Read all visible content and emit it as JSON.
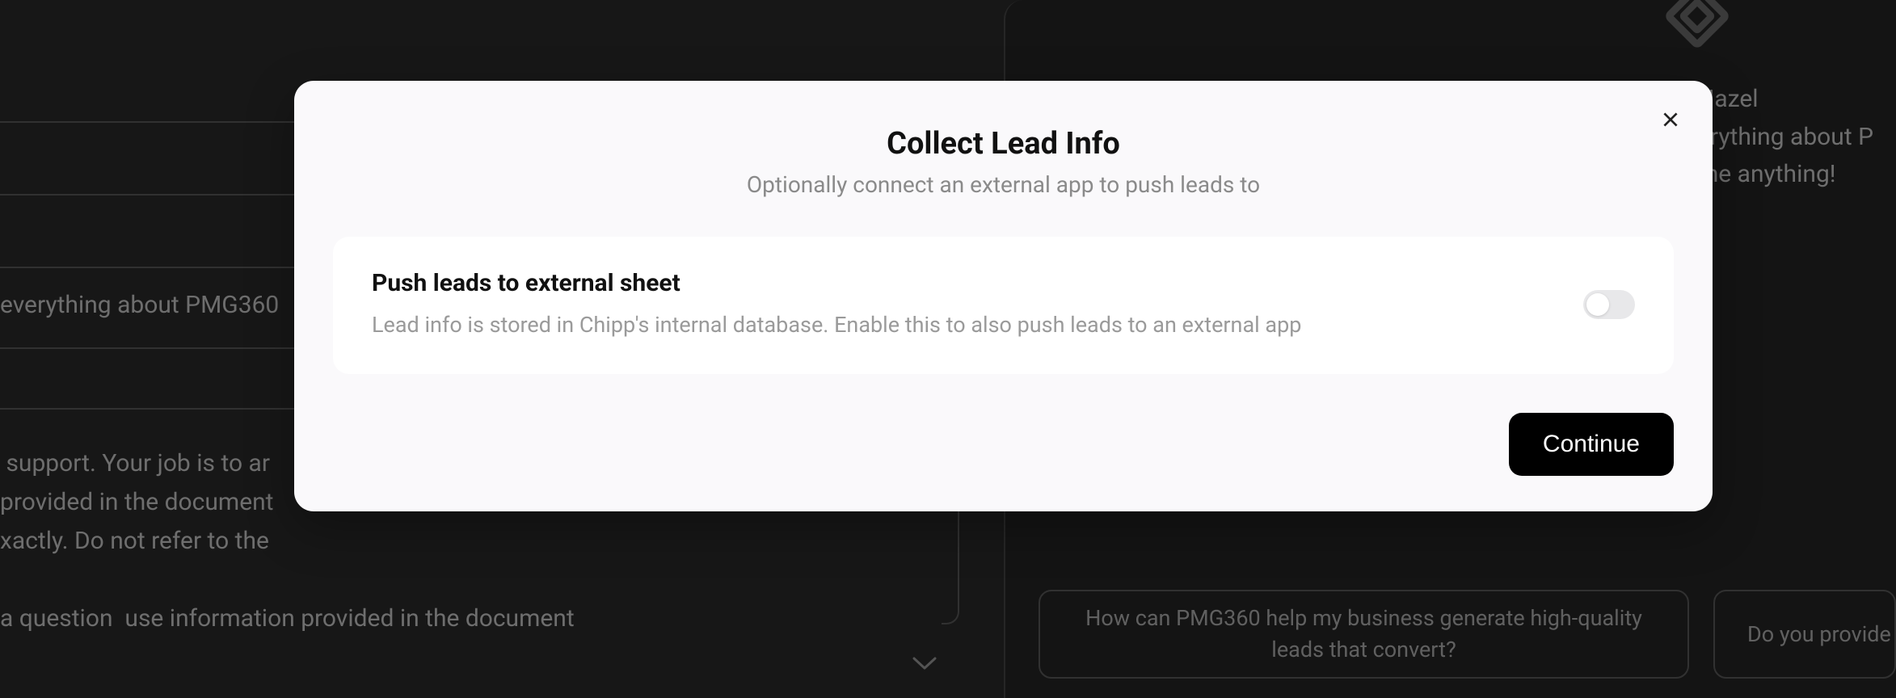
{
  "background": {
    "leftText1": "everything about PMG360",
    "leftText2": "support. Your job is to ar\nprovided in the document\nxactly. Do not refer to the\n\na question  use information provided in the document",
    "rightText1": "Hazel",
    "rightText2": "erything about P",
    "rightText3": "me anything!",
    "suggestion1": "How can PMG360 help my business generate high-quality leads that convert?",
    "suggestion2": "Do you provide"
  },
  "modal": {
    "title": "Collect Lead Info",
    "subtitle": "Optionally connect an external app to push leads to",
    "option": {
      "title": "Push leads to external sheet",
      "description": "Lead info is stored in Chipp's internal database. Enable this to also push leads to an external app"
    },
    "continueLabel": "Continue"
  }
}
